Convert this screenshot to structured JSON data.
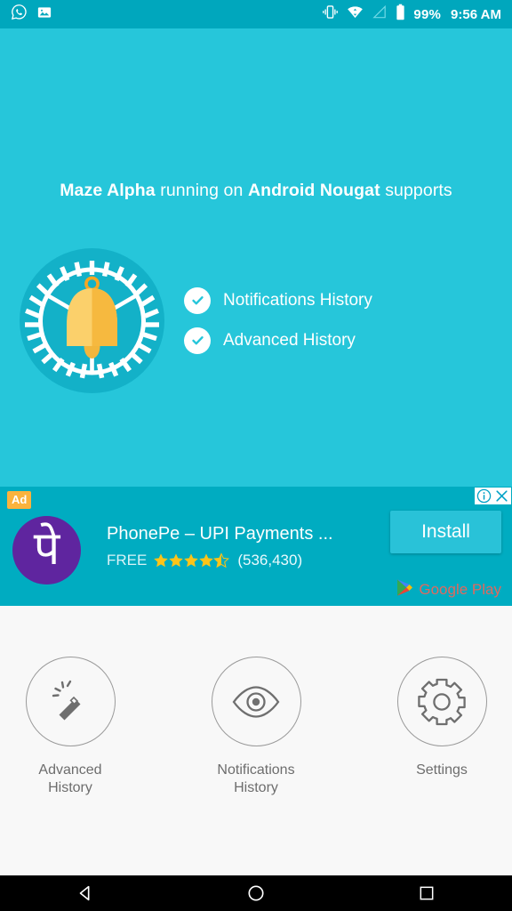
{
  "status_bar": {
    "left_icons": [
      "whatsapp-icon",
      "image-icon"
    ],
    "right_icons": [
      "vibrate-icon",
      "wifi-icon",
      "signal-icon",
      "battery-icon"
    ],
    "battery_percent": "99%",
    "time": "9:56 AM",
    "background_color": "#00a7bd"
  },
  "hero": {
    "headline_part1": "Maze Alpha",
    "headline_part2": " running on ",
    "headline_part3": "Android Nougat",
    "headline_part4": " supports",
    "icon_name": "bell-clock-icon",
    "background_color": "#26c6da",
    "bell_circle_color": "#13b1c8",
    "bell_color": "#f8c651",
    "features": [
      {
        "label": "Notifications History",
        "icon": "check-circle-icon"
      },
      {
        "label": "Advanced History",
        "icon": "check-circle-icon"
      }
    ]
  },
  "ad": {
    "badge": "Ad",
    "title": "PhonePe – UPI Payments ...",
    "price": "FREE",
    "rating": 4.5,
    "rating_count": "(536,430)",
    "install_label": "Install",
    "store_label": "Google Play",
    "logo_glyph": "पे",
    "logo_color": "#5f259f",
    "background_color": "#00acc1",
    "info_icon": "info-icon",
    "close_icon": "close-icon"
  },
  "tiles": [
    {
      "icon": "magic-wand-icon",
      "label_line1": "Advanced",
      "label_line2": "History"
    },
    {
      "icon": "eye-icon",
      "label_line1": "Notifications",
      "label_line2": "History"
    },
    {
      "icon": "gear-icon",
      "label_line1": "Settings",
      "label_line2": ""
    }
  ],
  "navbar": {
    "back": "back-button",
    "home": "home-button",
    "recents": "recents-button"
  }
}
